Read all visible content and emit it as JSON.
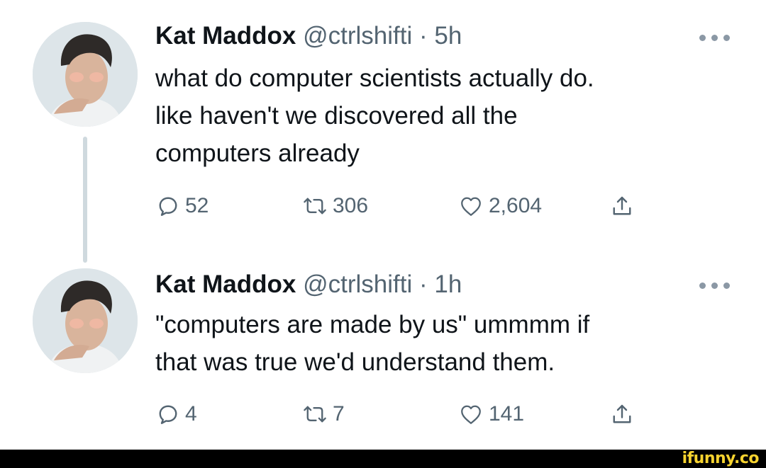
{
  "tweets": [
    {
      "author": {
        "name": "Kat Maddox",
        "handle": "@ctrlshifti"
      },
      "separator": "·",
      "time": "5h",
      "text_lines": [
        "what do computer scientists actually do.",
        "like haven't we discovered all the",
        "computers already"
      ],
      "stats": {
        "replies": "52",
        "retweets": "306",
        "likes": "2,604"
      }
    },
    {
      "author": {
        "name": "Kat Maddox",
        "handle": "@ctrlshifti"
      },
      "separator": "·",
      "time": "1h",
      "text_lines": [
        "\"computers are made by us\" ummmm if",
        "that was true we'd understand them."
      ],
      "stats": {
        "replies": "4",
        "retweets": "7",
        "likes": "141"
      }
    }
  ],
  "icons": {
    "reply": "speech-bubble-icon",
    "retweet": "retweet-arrows-icon",
    "like": "heart-outline-icon",
    "share": "share-upload-icon",
    "more": "more-dots-icon"
  },
  "colors": {
    "text_primary": "#0f1419",
    "text_secondary": "#536471",
    "thread_line": "#cfd9de",
    "watermark": "#f7d32f",
    "footer_bar": "#000000"
  },
  "watermark": {
    "text": "ifunny.co"
  }
}
